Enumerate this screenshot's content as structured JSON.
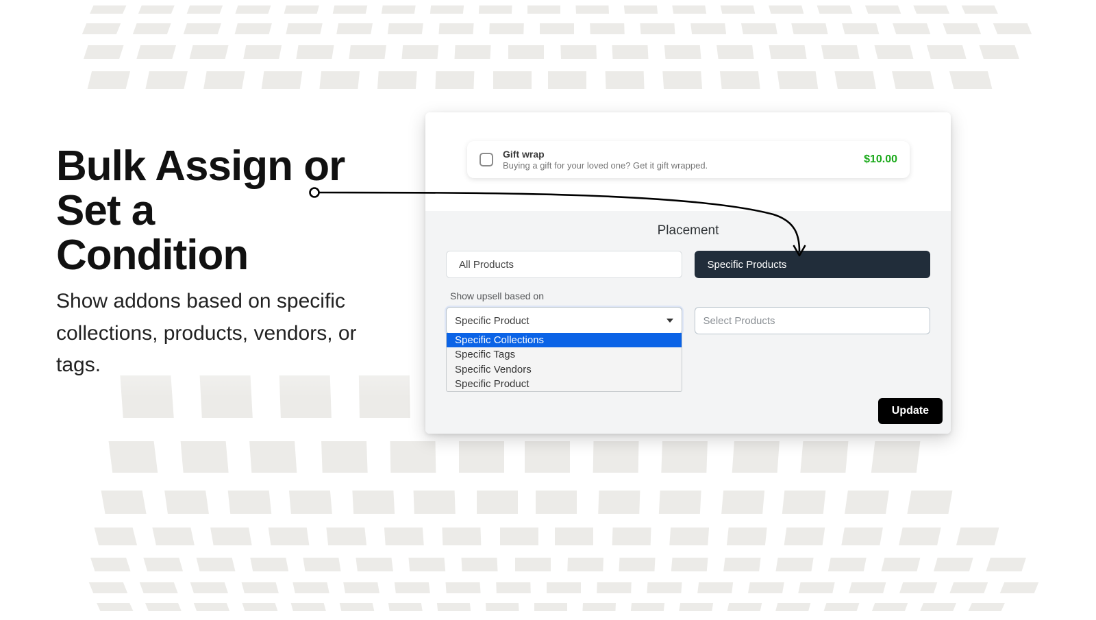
{
  "left": {
    "title_line1": "Bulk Assign or Set a",
    "title_line2": "Condition",
    "subtitle": "Show addons based on specific collections, products, vendors, or tags."
  },
  "panel": {
    "gift": {
      "title": "Gift wrap",
      "description": "Buying a gift for your loved one? Get it gift wrapped.",
      "price": "$10.00"
    },
    "placement": {
      "label": "Placement",
      "tabs": {
        "all": "All Products",
        "specific": "Specific Products"
      },
      "upsell_label": "Show upsell based on",
      "select_value": "Specific Product",
      "dropdown": {
        "opt0": "Specific Collections",
        "opt1": "Specific Tags",
        "opt2": "Specific Vendors",
        "opt3": "Specific Product"
      },
      "select_products_placeholder": "Select Products",
      "update": "Update"
    }
  }
}
